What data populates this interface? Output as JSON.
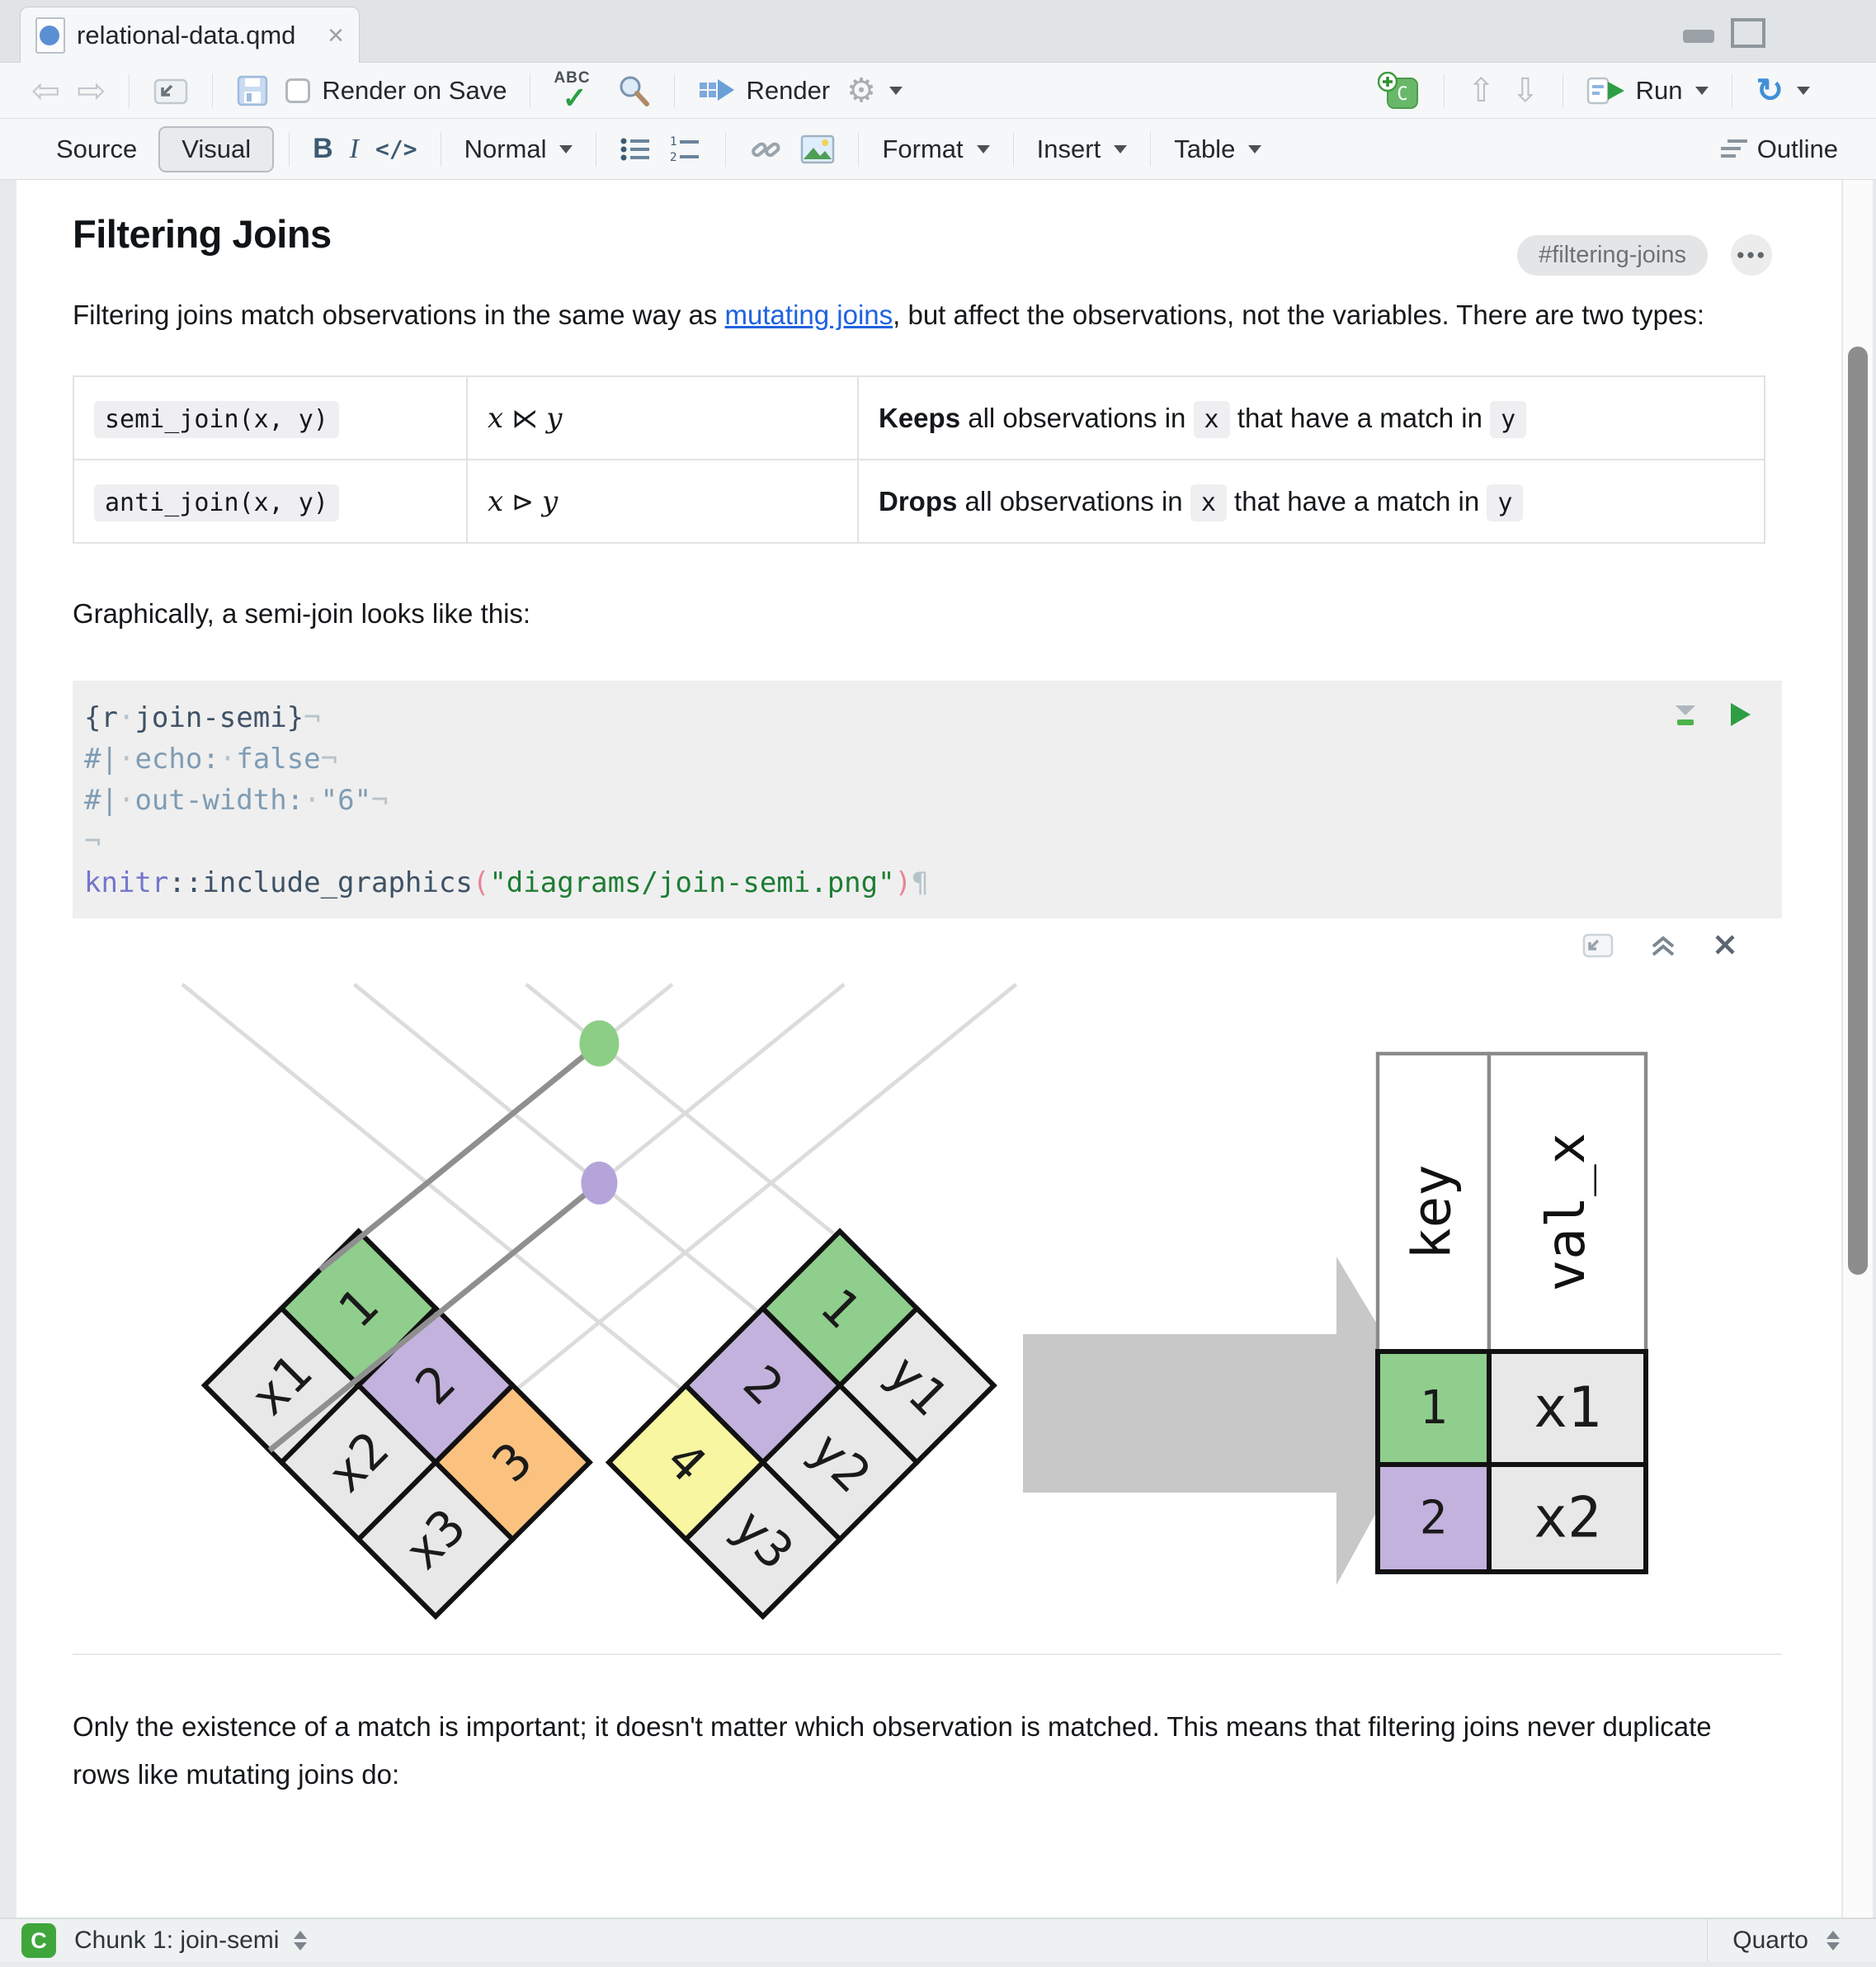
{
  "window": {
    "tab_title": "relational-data.qmd"
  },
  "icons": {
    "back": "⇦",
    "forward": "⇨",
    "up": "⇧",
    "down": "⇩",
    "gear": "⚙",
    "rerun": "↻",
    "ellipsis": "●●●",
    "close": "×",
    "spellcheck": "ABC",
    "spellcheck_check": "✓"
  },
  "toolbar": {
    "render_on_save": "Render on Save",
    "render": "Render",
    "run": "Run"
  },
  "format_bar": {
    "source": "Source",
    "visual": "Visual",
    "bold": "B",
    "italic": "I",
    "code": "</>",
    "paragraph_style": "Normal",
    "format": "Format",
    "insert": "Insert",
    "table": "Table",
    "outline": "Outline"
  },
  "doc": {
    "heading": "Filtering Joins",
    "anchor_badge": "#filtering-joins",
    "intro_before": "Filtering joins match observations in the same way as ",
    "intro_link": "mutating joins",
    "intro_after": ", but affect the observations, not the variables. There are two types:",
    "graphically": "Graphically, a semi-join looks like this:",
    "closing": "Only the existence of a match is important; it doesn't matter which observation is matched. This means that filtering joins never duplicate rows like mutating joins do:"
  },
  "join_table": {
    "rows": [
      {
        "code": "semi_join(x, y)",
        "math_x": "x",
        "math_op": "⋉",
        "math_y": "y",
        "verb": "Keeps",
        "mid1": " all observations in ",
        "arg1": "x",
        "mid2": " that have a match in ",
        "arg2": "y"
      },
      {
        "code": "anti_join(x, y)",
        "math_x": "x",
        "math_op": "⊳",
        "math_y": "y",
        "verb": "Drops",
        "mid1": " all observations in ",
        "arg1": "x",
        "mid2": " that have a match in ",
        "arg2": "y"
      }
    ]
  },
  "chunk": {
    "lines": [
      [
        [
          "{r",
          "code"
        ],
        [
          "·",
          "ws"
        ],
        [
          "join-semi}",
          "code"
        ],
        [
          "¬",
          "ws"
        ]
      ],
      [
        [
          "#|",
          "comment"
        ],
        [
          "·",
          "ws"
        ],
        [
          "echo:",
          "comment"
        ],
        [
          "·",
          "ws"
        ],
        [
          "false",
          "comment"
        ],
        [
          "¬",
          "ws"
        ]
      ],
      [
        [
          "#|",
          "comment"
        ],
        [
          "·",
          "ws"
        ],
        [
          "out-width:",
          "comment"
        ],
        [
          "·",
          "ws"
        ],
        [
          "\"6\"",
          "comment"
        ],
        [
          "¬",
          "ws"
        ]
      ],
      [
        [
          "¬",
          "ws"
        ]
      ],
      [
        [
          "knitr",
          "pkg"
        ],
        [
          "::include_graphics",
          "code"
        ],
        [
          "(",
          "paren"
        ],
        [
          "\"diagrams/join-semi.png\"",
          "string"
        ],
        [
          ")",
          "paren"
        ],
        [
          "¶",
          "ws"
        ]
      ]
    ]
  },
  "diagram": {
    "left_table": {
      "keys": [
        {
          "label": "1",
          "color": "#8fce8d"
        },
        {
          "label": "2",
          "color": "#c3b2dd"
        },
        {
          "label": "3",
          "color": "#fbc27f"
        }
      ],
      "values": [
        "x1",
        "x2",
        "x3"
      ]
    },
    "right_table": {
      "keys": [
        {
          "label": "1",
          "color": "#8fce8d"
        },
        {
          "label": "2",
          "color": "#c3b2dd"
        },
        {
          "label": "4",
          "color": "#f8f6a1"
        }
      ],
      "values": [
        "y1",
        "y2",
        "y3"
      ]
    },
    "dots": [
      {
        "key": "1",
        "color": "#8cce85"
      },
      {
        "key": "2",
        "color": "#b5a4d9"
      }
    ],
    "result_table": {
      "headers": [
        "key",
        "val_x"
      ],
      "rows": [
        {
          "key": "1",
          "key_color": "#8fce8d",
          "val": "x1"
        },
        {
          "key": "2",
          "key_color": "#c3b2dd",
          "val": "x2"
        }
      ]
    },
    "colors": {
      "arrow": "#c8c8c8",
      "lattice": "#dcdcdc",
      "dark_line": "#8f8f8f",
      "cell_gray": "#e8e8e8",
      "border": "#111111",
      "header_border": "#8a8a8a"
    }
  },
  "statusbar": {
    "chunk_badge": "C",
    "chunk_label": "Chunk 1: join-semi",
    "format_label": "Quarto"
  }
}
